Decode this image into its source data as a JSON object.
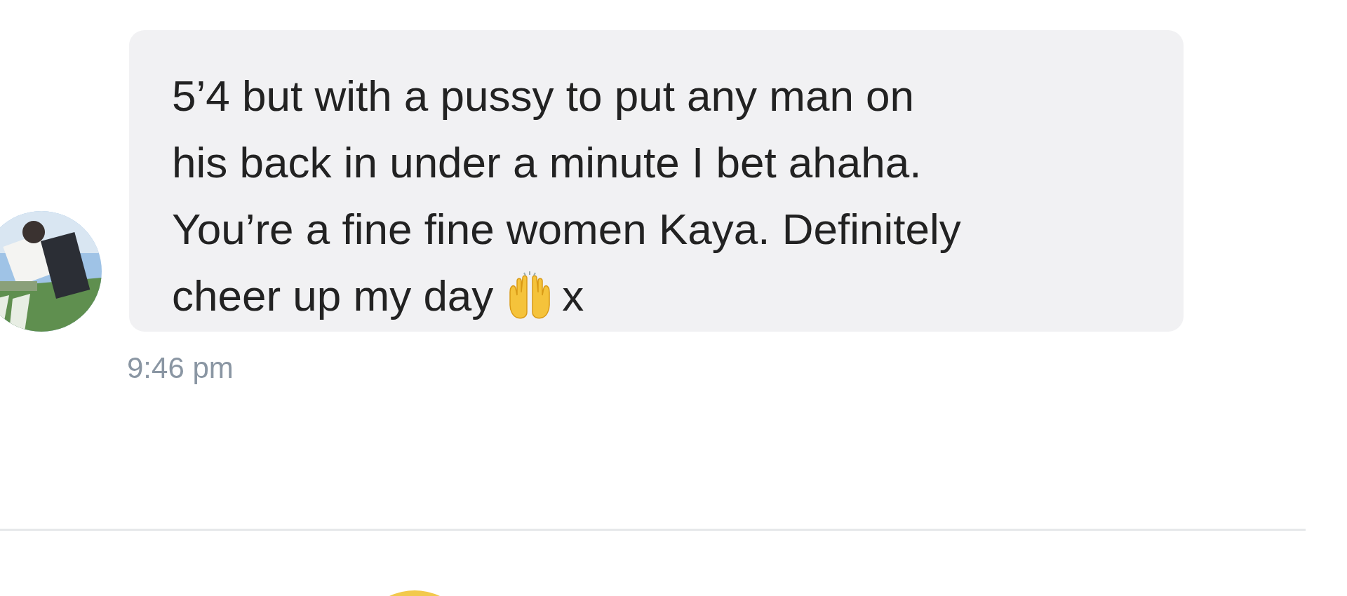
{
  "messages": [
    {
      "lines": [
        "5’4 but with a pussy to put any man on",
        "his back in under a minute I bet ahaha.",
        "You’re a fine fine women Kaya. Definitely",
        "cheer up my day"
      ],
      "text_after": "x",
      "time": "9:46 pm"
    }
  ]
}
